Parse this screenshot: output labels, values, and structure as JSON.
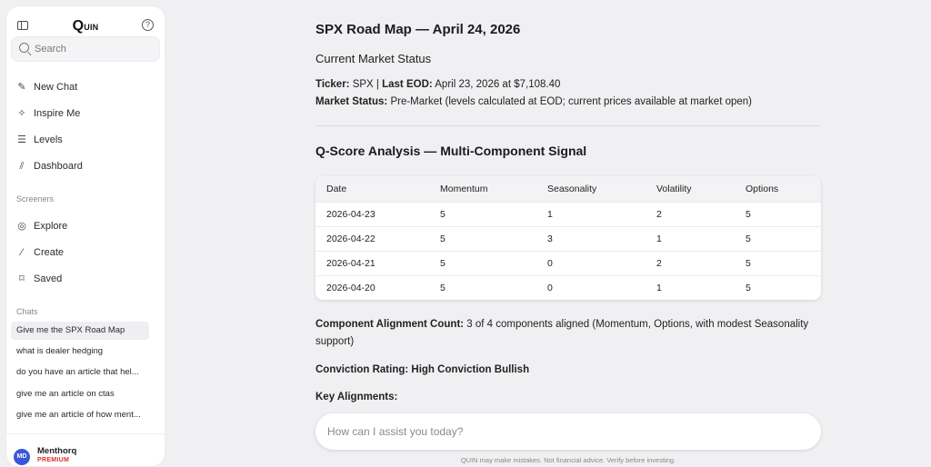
{
  "sidebar": {
    "logo": {
      "q": "Q",
      "rest": "UIN"
    },
    "help_glyph": "?",
    "search_placeholder": "Search",
    "nav": [
      {
        "label": "New Chat",
        "icon": "edit-icon"
      },
      {
        "label": "Inspire Me",
        "icon": "sparkles-icon"
      },
      {
        "label": "Levels",
        "icon": "list-icon"
      },
      {
        "label": "Dashboard",
        "icon": "chart-icon"
      }
    ],
    "screeners_label": "Screeners",
    "screeners": [
      {
        "label": "Explore",
        "icon": "compass-icon"
      },
      {
        "label": "Create",
        "icon": "wand-icon"
      },
      {
        "label": "Saved",
        "icon": "bookmark-icon"
      }
    ],
    "chats_label": "Chats",
    "chats": [
      "Give me the SPX Road Map",
      "what is dealer hedging",
      "do you have an article that hel...",
      "give me an article on ctas",
      "give me an article of how ment..."
    ],
    "user": {
      "initials": "MD",
      "name": "Menthorq",
      "plan": "PREMIUM"
    }
  },
  "main": {
    "title": "SPX Road Map — April 24, 2026",
    "subtitle": "Current Market Status",
    "ticker_label": "Ticker:",
    "ticker_value": " SPX | ",
    "last_eod_label": "Last EOD:",
    "last_eod_value": " April 23, 2026 at $7,108.40",
    "status_label": "Market Status:",
    "status_value": " Pre-Market (levels calculated at EOD; current prices available at market open)",
    "qscore_title": "Q-Score Analysis — Multi-Component Signal",
    "table": {
      "headers": [
        "Date",
        "Momentum",
        "Seasonality",
        "Volatility",
        "Options"
      ],
      "rows": [
        [
          "2026-04-23",
          "5",
          "1",
          "2",
          "5"
        ],
        [
          "2026-04-22",
          "5",
          "3",
          "1",
          "5"
        ],
        [
          "2026-04-21",
          "5",
          "0",
          "2",
          "5"
        ],
        [
          "2026-04-20",
          "5",
          "0",
          "1",
          "5"
        ]
      ]
    },
    "alignment_label": "Component Alignment Count:",
    "alignment_value": " 3 of 4 components aligned (Momentum, Options, with modest Seasonality support)",
    "conviction": "Conviction Rating: High Conviction Bullish",
    "key_alignments": "Key Alignments:",
    "composer_placeholder": "How can I assist you today?",
    "disclaimer": "QUIN may make mistakes. Not financial advice. Verify before investing."
  }
}
